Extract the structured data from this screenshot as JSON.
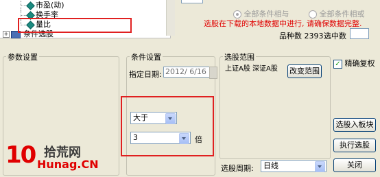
{
  "tree": {
    "items": [
      {
        "label": "市盈(动)"
      },
      {
        "label": "换手率"
      },
      {
        "label": "量比"
      }
    ],
    "group_label": "条件选股"
  },
  "top_right": {
    "radio_all_and": "全部条件相与",
    "radio_all_or": "全部条件相或",
    "hint": "选股在下载的本地数据中进行, 请确保数据完整.",
    "count_label": "品种数",
    "count_value": "2393",
    "selected_label": "选中数"
  },
  "params": {
    "title": "参数设置"
  },
  "conditions": {
    "title": "条件设置",
    "date_label": "指定日期:",
    "date_value": "2012/ 6/16",
    "operator_value": "大于",
    "threshold_value": "3",
    "unit_label": "倍"
  },
  "scope": {
    "title": "选股范围",
    "markets": "上证A股 深证A股",
    "change_button": "改变范围",
    "period_label": "选股周期:",
    "period_value": "日线"
  },
  "right": {
    "precise_label": "精确复权",
    "precise_checked": true,
    "to_block_button": "选股入板块",
    "execute_button": "执行选股",
    "close_button": "关闭"
  },
  "watermark": {
    "num": "10",
    "cn_name": "拾荒网",
    "domain": "Hunag.CN"
  }
}
